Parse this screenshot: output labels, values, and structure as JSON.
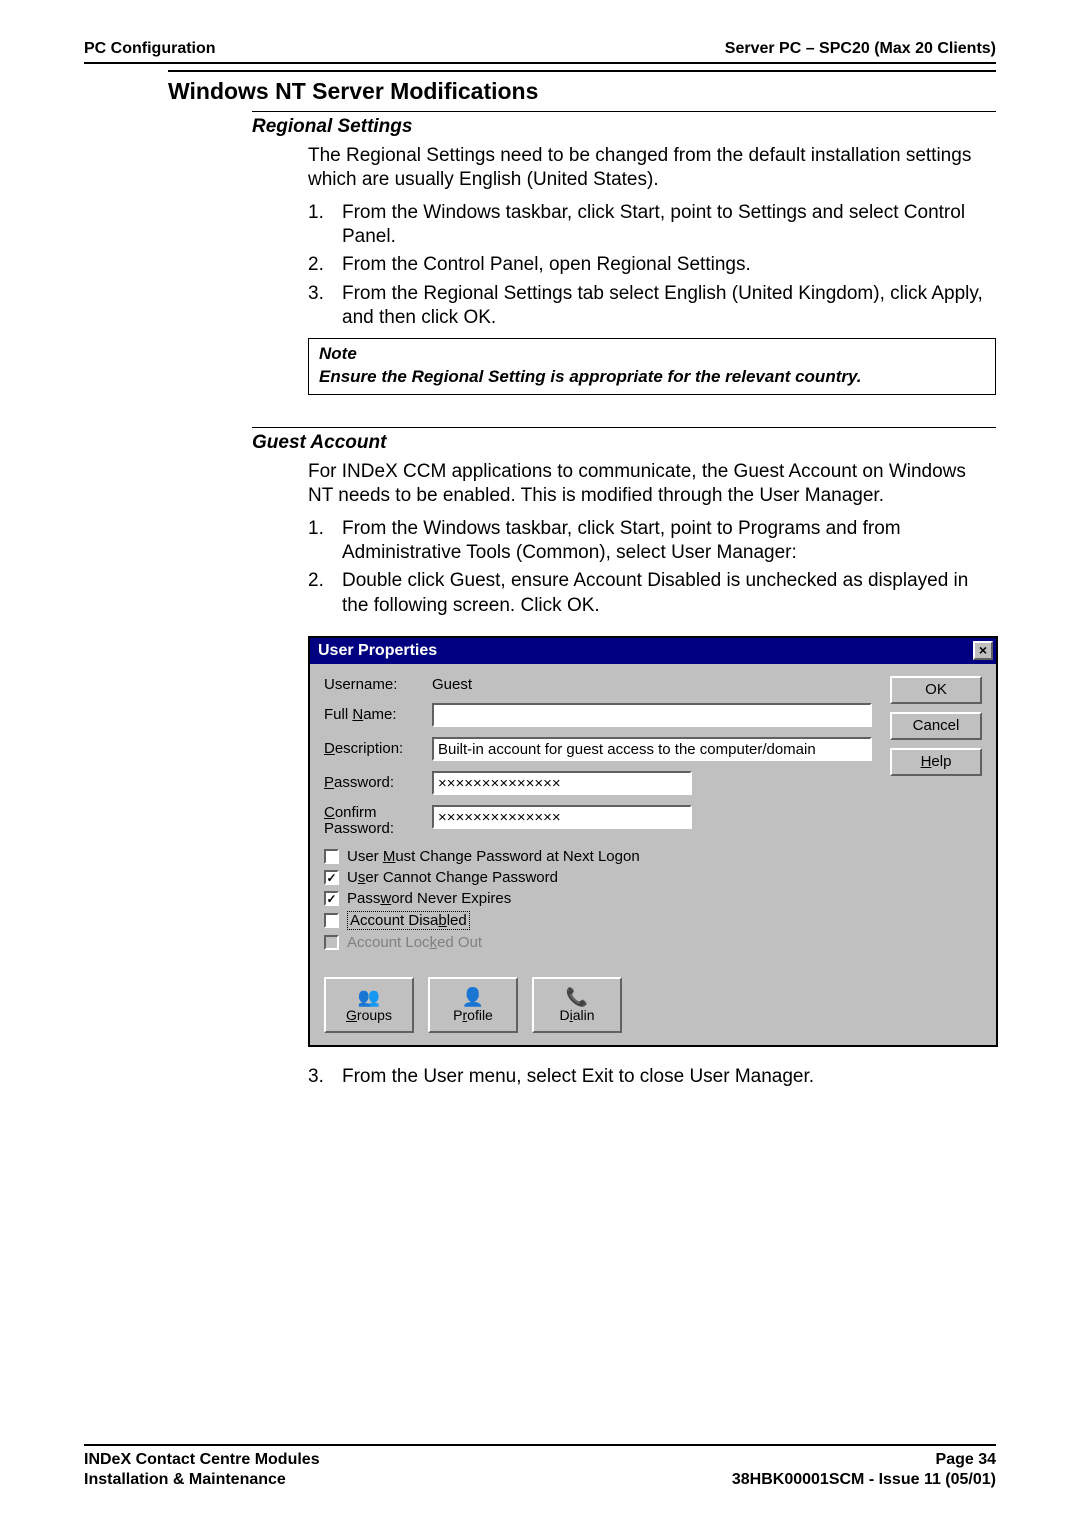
{
  "header": {
    "left": "PC Configuration",
    "right": "Server PC – SPC20 (Max 20 Clients)"
  },
  "section_title": "Windows NT Server Modifications",
  "regional": {
    "title": "Regional Settings",
    "intro": "The Regional Settings need to be changed from the default installation settings which are usually English (United States).",
    "step1": "From the Windows taskbar, click Start, point to Settings and select Control Panel.",
    "step2_pre": "From the Control Panel, open ",
    "step2_bold": "Regional Settings",
    "step2_post": ".",
    "step3_pre": "From the ",
    "step3_b1": "Regional Settings",
    "step3_mid1": " tab select ",
    "step3_b2": "English (United Kingdom)",
    "step3_mid2": ", click ",
    "step3_i1": "Apply",
    "step3_mid3": ", and then click ",
    "step3_i2": "OK",
    "step3_post": ".",
    "note_title": "Note",
    "note_body": "Ensure the Regional Setting is appropriate for the relevant country."
  },
  "guest": {
    "title": "Guest Account",
    "intro": "For INDeX CCM applications to communicate, the Guest Account on Windows NT needs to be enabled.  This is modified through the User Manager.",
    "step1_pre": "From the Windows taskbar, click Start, point to Programs and from Administrative Tools (Common), select ",
    "step1_bold": "User Manager",
    "step1_post": ":",
    "step2_pre": "Double click ",
    "step2_b1": "Guest",
    "step2_mid1": ", ensure ",
    "step2_b2": "Account Disabled",
    "step2_mid2": " is unchecked as displayed in the following screen.  Click ",
    "step2_i1": "OK",
    "step2_post": ".",
    "step3_pre": "From the ",
    "step3_b1": "User menu",
    "step3_mid1": ", select ",
    "step3_b2": "Exit",
    "step3_post": " to close User Manager."
  },
  "dialog": {
    "title": "User Properties",
    "close": "×",
    "labels": {
      "username_plain": "Username:",
      "fullname_pre": "Full ",
      "fullname_ul": "N",
      "fullname_post": "ame:",
      "desc_ul": "D",
      "desc_post": "escription:",
      "pass_ul": "P",
      "pass_post": "assword:",
      "conf_ul": "C",
      "conf_post": "onfirm Password:"
    },
    "values": {
      "username": "Guest",
      "fullname": "",
      "description": "Built-in account for guest access to the computer/domain",
      "password": "××××××××××××××",
      "confirm": "××××××××××××××"
    },
    "checks": {
      "must_change_pre": "User ",
      "must_change_ul": "M",
      "must_change_post": "ust Change Password at Next Logon",
      "cannot_change_pre": "U",
      "cannot_change_ul": "s",
      "cannot_change_post": "er Cannot Change Password",
      "never_exp_pre": "Pass",
      "never_exp_ul": "w",
      "never_exp_post": "ord Never Expires",
      "disabled_pre": "Account Disa",
      "disabled_ul": "b",
      "disabled_post": "led",
      "locked_pre": "Account Loc",
      "locked_ul": "k",
      "locked_post": "ed Out"
    },
    "buttons": {
      "ok": "OK",
      "cancel": "Cancel",
      "help_ul": "H",
      "help_post": "elp",
      "groups_ul": "G",
      "groups_post": "roups",
      "profile_pre": "P",
      "profile_ul": "r",
      "profile_post": "ofile",
      "dialin_pre": "D",
      "dialin_ul": "i",
      "dialin_post": "alin"
    }
  },
  "footer": {
    "left1": "INDeX Contact Centre Modules",
    "left2": "Installation & Maintenance",
    "right1": "Page 34",
    "right2": "38HBK00001SCM - Issue 11 (05/01)"
  }
}
